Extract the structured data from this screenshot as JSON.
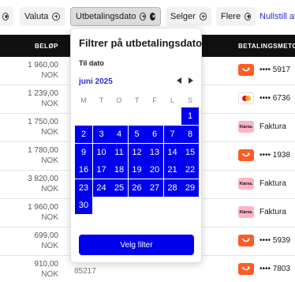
{
  "filters": {
    "chips": [
      {
        "label": "",
        "icon": "plus-circle-icon"
      },
      {
        "label": "Valuta",
        "icon": "plus-circle-icon"
      },
      {
        "label": "Utbetalingsdato",
        "icon": "close-circle-icon"
      },
      {
        "label": "Selger",
        "icon": "plus-circle-icon"
      },
      {
        "label": "Flere",
        "icon": "plus-circle-icon"
      }
    ],
    "reset_label": "Nullstill alle"
  },
  "table": {
    "headers": {
      "amount": "BELØP",
      "method": "BETALINGSMETODE"
    },
    "rows": [
      {
        "amount": "1 960,00",
        "currency": "NOK",
        "method_text": "•••• 5917",
        "logo": "vipps"
      },
      {
        "amount": "1 239,00",
        "currency": "NOK",
        "method_text": "•••• 6736",
        "logo": "mastercard"
      },
      {
        "amount": "1 750,00",
        "currency": "NOK",
        "method_text": "Faktura",
        "logo": "klarna"
      },
      {
        "amount": "1 780,00",
        "currency": "NOK",
        "method_text": "•••• 1938",
        "logo": "vipps"
      },
      {
        "amount": "3 820,00",
        "currency": "NOK",
        "method_text": "Faktura",
        "logo": "klarna"
      },
      {
        "amount": "1 960,00",
        "currency": "NOK",
        "method_text": "Faktura",
        "logo": "klarna"
      },
      {
        "amount": "699,00",
        "currency": "NOK",
        "method_text": "•••• 5939",
        "logo": "vipps"
      },
      {
        "amount": "910,00",
        "currency": "NOK",
        "method_text": "•••• 7803",
        "logo": "vipps"
      }
    ],
    "partial_ref": "85217",
    "klarna_text": "Klarna."
  },
  "popover": {
    "title": "Filtrer på utbetalingsdato",
    "to_label": "Til dato",
    "month_label": "juni 2025",
    "weekdays": [
      "M",
      "T",
      "O",
      "T",
      "F",
      "L",
      "S"
    ],
    "days": [
      "1",
      "2",
      "3",
      "4",
      "5",
      "6",
      "7",
      "8",
      "9",
      "10",
      "11",
      "12",
      "13",
      "14",
      "15",
      "16",
      "17",
      "18",
      "19",
      "20",
      "21",
      "22",
      "23",
      "24",
      "25",
      "26",
      "27",
      "28",
      "29",
      "30"
    ],
    "apply_label": "Velg filter"
  },
  "colors": {
    "accent": "#0000ee",
    "link": "#2b2bd9",
    "header_bg": "#101010",
    "vipps": "#ff5b24",
    "klarna": "#ffb3c7"
  }
}
